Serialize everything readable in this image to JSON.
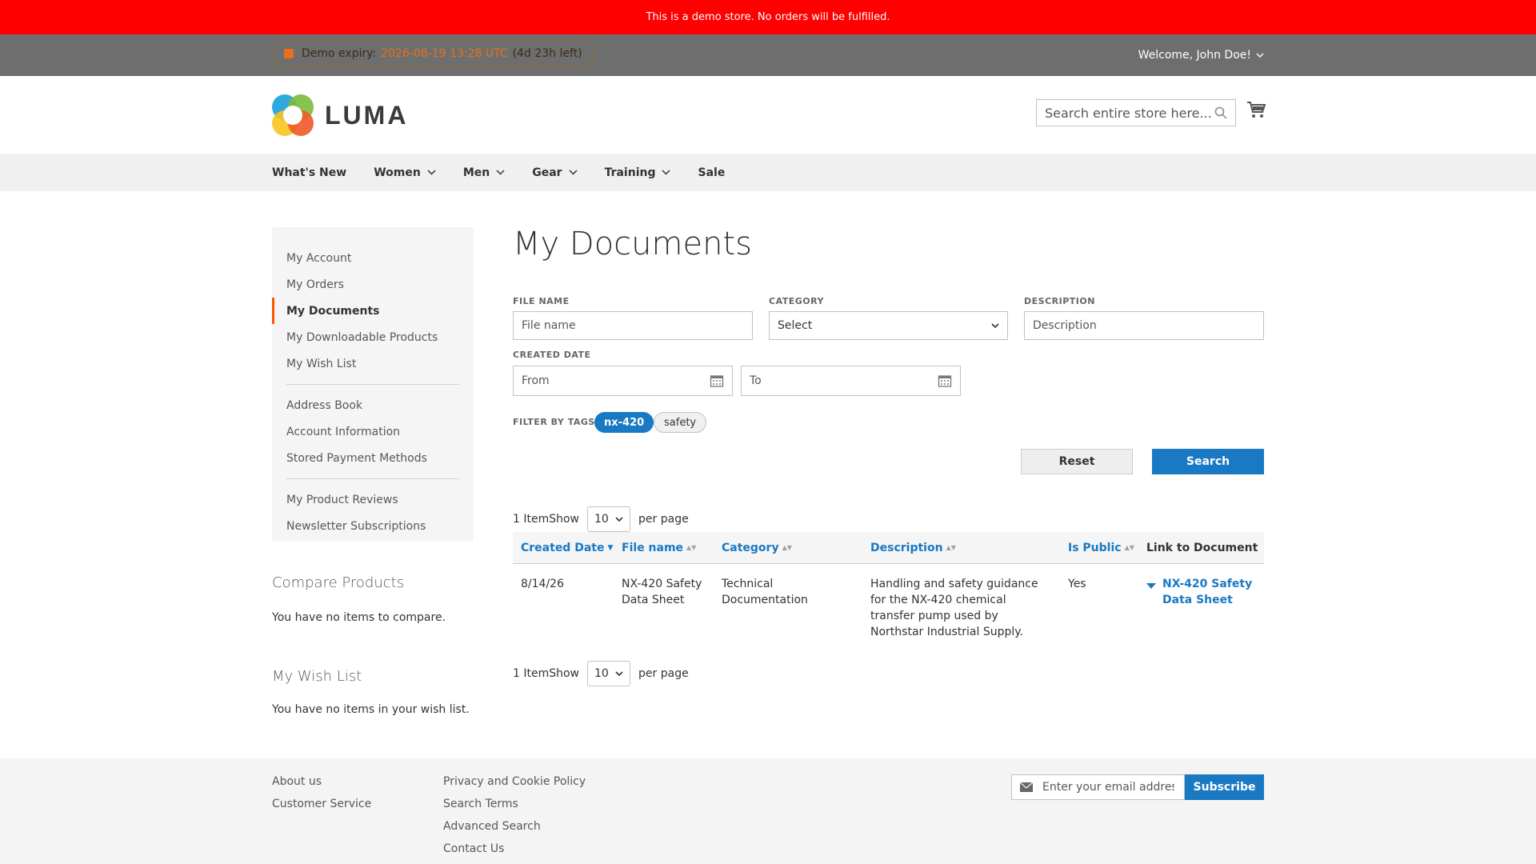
{
  "demo_notice": "This is a demo store. No orders will be fulfilled.",
  "panel": {
    "expiry_label": "Demo expiry:",
    "expiry_date": "2026-08-19 13:28 UTC",
    "expiry_left": "(4d 23h left)",
    "welcome": "Welcome, John Doe!"
  },
  "header": {
    "logo_text": "LUMA",
    "search_placeholder": "Search entire store here..."
  },
  "nav": {
    "items": [
      {
        "label": "What's New",
        "has_dropdown": false
      },
      {
        "label": "Women",
        "has_dropdown": true
      },
      {
        "label": "Men",
        "has_dropdown": true
      },
      {
        "label": "Gear",
        "has_dropdown": true
      },
      {
        "label": "Training",
        "has_dropdown": true
      },
      {
        "label": "Sale",
        "has_dropdown": false
      }
    ]
  },
  "sidebar": {
    "items": [
      {
        "label": "My Account"
      },
      {
        "label": "My Orders"
      },
      {
        "label": "My Documents",
        "active": true
      },
      {
        "label": "My Downloadable Products"
      },
      {
        "label": "My Wish List"
      },
      {
        "label": "Address Book"
      },
      {
        "label": "Account Information"
      },
      {
        "label": "Stored Payment Methods"
      },
      {
        "label": "My Product Reviews"
      },
      {
        "label": "Newsletter Subscriptions"
      }
    ]
  },
  "compare": {
    "title": "Compare Products",
    "text": "You have no items to compare."
  },
  "wishlist": {
    "title": "My Wish List",
    "text": "You have no items in your wish list."
  },
  "main": {
    "title": "My Documents",
    "filters": {
      "file_name_label": "FILE NAME",
      "file_name_placeholder": "File name",
      "category_label": "CATEGORY",
      "category_value": "Select",
      "description_label": "DESCRIPTION",
      "description_placeholder": "Description",
      "created_date_label": "CREATED DATE",
      "from_placeholder": "From",
      "to_placeholder": "To",
      "tags_label": "FILTER BY TAGS:",
      "tags": [
        {
          "label": "nx-420",
          "active": true
        },
        {
          "label": "safety",
          "active": false
        }
      ],
      "reset_label": "Reset",
      "search_label": "Search"
    },
    "toolbar": {
      "count": "1 Item",
      "show": "Show",
      "limit": "10",
      "per_page": "per page"
    },
    "table": {
      "columns": [
        {
          "label": "Created Date",
          "sort": "desc"
        },
        {
          "label": "File name",
          "sort": "none"
        },
        {
          "label": "Category",
          "sort": "none"
        },
        {
          "label": "Description",
          "sort": "none"
        },
        {
          "label": "Is Public",
          "sort": "none"
        },
        {
          "label": "Link to Document",
          "sort": null
        }
      ],
      "rows": [
        {
          "created_date": "8/14/26",
          "file_name": "NX-420 Safety Data Sheet",
          "category": "Technical Documentation",
          "description": "Handling and safety guidance for the NX-420 chemical transfer pump used by Northstar Industrial Supply.",
          "is_public": "Yes",
          "link": "NX-420 Safety Data Sheet"
        }
      ]
    }
  },
  "footer": {
    "col1": [
      "About us",
      "Customer Service"
    ],
    "col2": [
      "Privacy and Cookie Policy",
      "Search Terms",
      "Advanced Search",
      "Contact Us"
    ],
    "newsletter_placeholder": "Enter your email address",
    "subscribe_label": "Subscribe"
  },
  "colors": {
    "accent": "#1979c3",
    "notice": "#ff0000",
    "active_marker": "#ff5501"
  }
}
